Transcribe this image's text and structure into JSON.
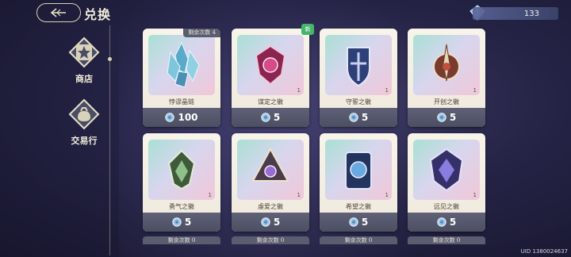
{
  "header": {
    "title": "兑换"
  },
  "currency": {
    "amount": "133",
    "icon": "gem-icon"
  },
  "sidebar": [
    {
      "label": "商店",
      "icon": "shop-star-icon",
      "active": true
    },
    {
      "label": "交易行",
      "icon": "trade-bag-icon",
      "active": false
    }
  ],
  "shop_items": [
    {
      "name": "悖谬晶链",
      "price": "100",
      "quantity": "",
      "limit": "剩余次数 4",
      "new": false,
      "icon": "crystal-shard-icon"
    },
    {
      "name": "谋定之徽",
      "price": "5",
      "quantity": "1",
      "limit": "",
      "new": true,
      "icon": "scheme-emblem-icon"
    },
    {
      "name": "守誓之徽",
      "price": "5",
      "quantity": "1",
      "limit": "",
      "new": false,
      "icon": "shield-emblem-icon"
    },
    {
      "name": "开创之徽",
      "price": "5",
      "quantity": "1",
      "limit": "",
      "new": false,
      "icon": "sword-emblem-icon"
    },
    {
      "name": "勇气之徽",
      "price": "5",
      "quantity": "1",
      "limit": "",
      "new": false,
      "icon": "courage-emblem-icon"
    },
    {
      "name": "虔爱之徽",
      "price": "5",
      "quantity": "1",
      "limit": "",
      "new": false,
      "icon": "devotion-emblem-icon"
    },
    {
      "name": "希望之徽",
      "price": "5",
      "quantity": "1",
      "limit": "",
      "new": false,
      "icon": "hope-emblem-icon"
    },
    {
      "name": "远见之徽",
      "price": "5",
      "quantity": "1",
      "limit": "",
      "new": false,
      "icon": "vision-emblem-icon"
    }
  ],
  "bottom_limits": [
    "剩余次数 0",
    "剩余次数 0",
    "剩余次数 0",
    "剩余次数 0"
  ],
  "badges": {
    "new": "新"
  },
  "footer": {
    "uid": "UID 1380024637"
  }
}
